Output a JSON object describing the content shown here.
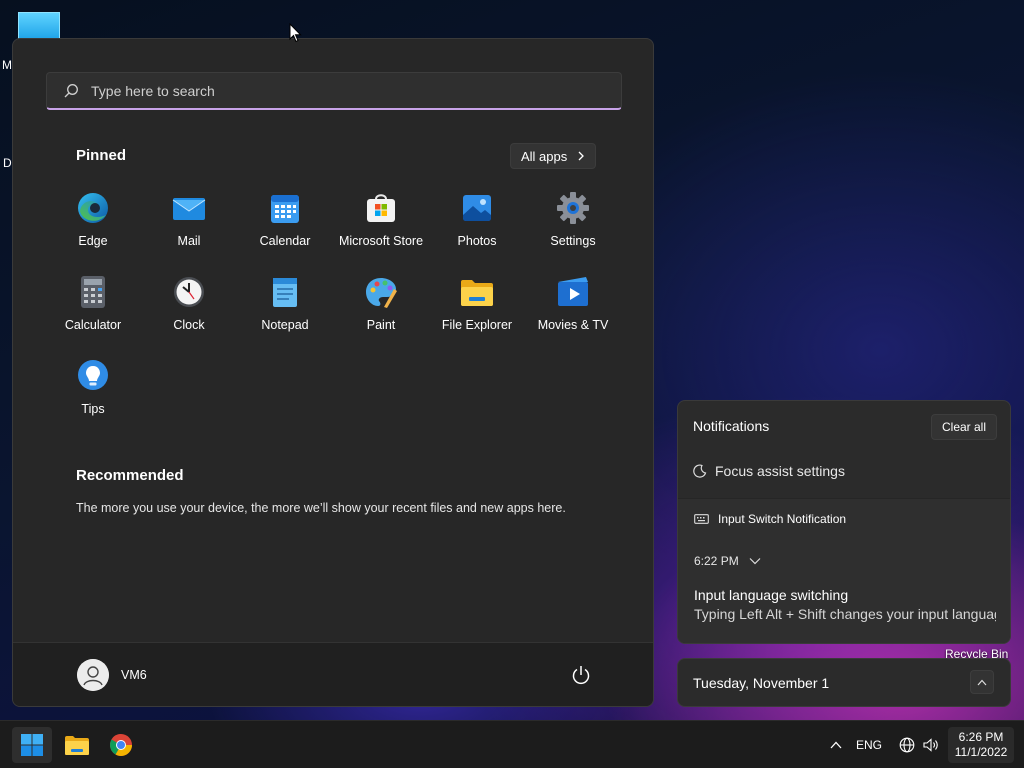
{
  "desktop": {
    "letters": [
      "M",
      "Da"
    ],
    "recycle_bin_label": "Recycle Bin"
  },
  "start_menu": {
    "search_placeholder": "Type here to search",
    "pinned_title": "Pinned",
    "all_apps_label": "All apps",
    "pinned_apps": [
      {
        "label": "Edge",
        "icon": "edge-icon"
      },
      {
        "label": "Mail",
        "icon": "mail-icon"
      },
      {
        "label": "Calendar",
        "icon": "calendar-icon"
      },
      {
        "label": "Microsoft Store",
        "icon": "store-icon"
      },
      {
        "label": "Photos",
        "icon": "photos-icon"
      },
      {
        "label": "Settings",
        "icon": "settings-icon"
      },
      {
        "label": "Calculator",
        "icon": "calculator-icon"
      },
      {
        "label": "Clock",
        "icon": "clock-icon"
      },
      {
        "label": "Notepad",
        "icon": "notepad-icon"
      },
      {
        "label": "Paint",
        "icon": "paint-icon"
      },
      {
        "label": "File Explorer",
        "icon": "file-explorer-icon"
      },
      {
        "label": "Movies & TV",
        "icon": "movies-tv-icon"
      },
      {
        "label": "Tips",
        "icon": "tips-icon"
      }
    ],
    "recommended_title": "Recommended",
    "recommended_text": "The more you use your device, the more we’ll show your recent files and new apps here.",
    "user_name": "VM6"
  },
  "notifications": {
    "title": "Notifications",
    "clear_all_label": "Clear all",
    "focus_assist_label": "Focus assist settings",
    "card": {
      "app_name": "Input Switch Notification",
      "time": "6:22 PM",
      "heading": "Input language switching",
      "body": "Typing Left Alt + Shift changes your input language"
    }
  },
  "date_panel": {
    "date": "Tuesday, November 1"
  },
  "taskbar": {
    "language": "ENG",
    "time": "6:26 PM",
    "date": "11/1/2022"
  }
}
